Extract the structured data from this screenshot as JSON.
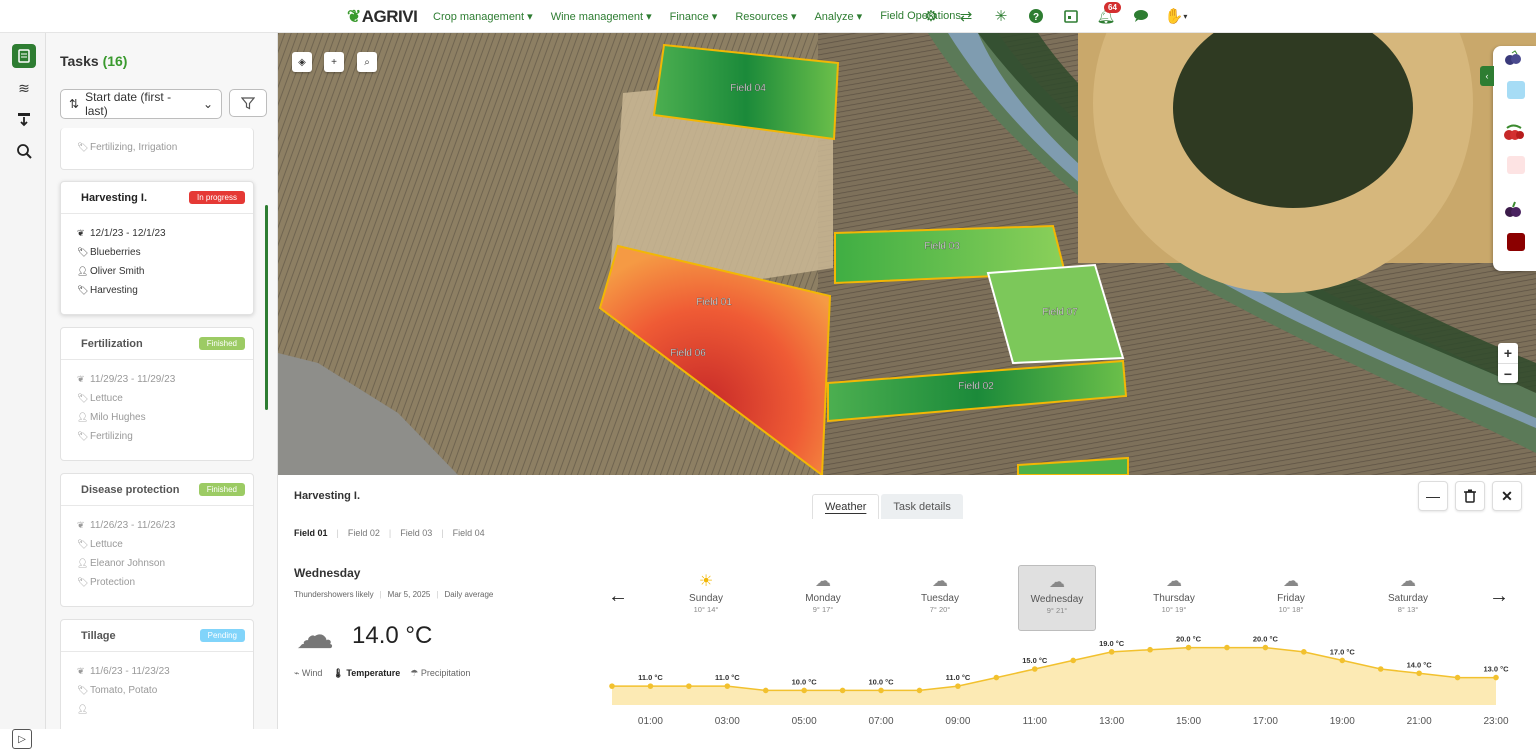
{
  "app": {
    "logo": "AGRIVI"
  },
  "nav": {
    "items": [
      "Crop management",
      "Wine management",
      "Finance",
      "Resources",
      "Analyze",
      "Field Operations"
    ],
    "notifications_count": "64",
    "icons": [
      "gear-icon",
      "transfer-icon",
      "network-icon",
      "help-icon",
      "calendar-icon",
      "bell-icon",
      "chat-icon",
      "user-icon"
    ]
  },
  "tasks": {
    "title": "Tasks",
    "count": "(16)",
    "sort_label": "Start date (first - last)",
    "partial_tag": "Fertilizing, Irrigation",
    "cards": [
      {
        "name": "Harvesting I.",
        "status": "In progress",
        "date": "12/1/23 - 12/1/23",
        "crop": "Blueberries",
        "person": "Oliver Smith",
        "type": "Harvesting"
      },
      {
        "name": "Fertilization",
        "status": "Finished",
        "date": "11/29/23 - 11/29/23",
        "crop": "Lettuce",
        "person": "Milo Hughes",
        "type": "Fertilizing"
      },
      {
        "name": "Disease protection",
        "status": "Finished",
        "date": "11/26/23 - 11/26/23",
        "crop": "Lettuce",
        "person": "Eleanor Johnson",
        "type": "Protection"
      },
      {
        "name": "Tillage",
        "status": "Pending",
        "date": "11/6/23 - 11/23/23",
        "crop": "Tomato, Potato",
        "person": "",
        "type": ""
      }
    ]
  },
  "map": {
    "fields": [
      "Field 04",
      "Field 03",
      "Field 01",
      "Field 06",
      "Field 07",
      "Field 02"
    ],
    "palette_colors": [
      "#a6dcf5",
      "#fde3e3",
      "#8b0000"
    ]
  },
  "details": {
    "title": "Harvesting I.",
    "tabs": [
      "Weather",
      "Task details"
    ],
    "field_tabs": [
      "Field 01",
      "Field 02",
      "Field 03",
      "Field 04"
    ],
    "day": "Wednesday",
    "condition": "Thundershowers likely",
    "date": "Mar 5, 2025",
    "avg_label": "Daily average",
    "temp": "14.0 °C",
    "metrics": [
      "Wind",
      "Temperature",
      "Precipitation"
    ],
    "week": [
      {
        "day": "Sunday",
        "hl": "10° 14°"
      },
      {
        "day": "Monday",
        "hl": "9° 17°"
      },
      {
        "day": "Tuesday",
        "hl": "7° 20°"
      },
      {
        "day": "Wednesday",
        "hl": "9° 21°"
      },
      {
        "day": "Thursday",
        "hl": "10° 19°"
      },
      {
        "day": "Friday",
        "hl": "10° 18°"
      },
      {
        "day": "Saturday",
        "hl": "8° 13°"
      }
    ]
  },
  "chart_data": {
    "type": "area",
    "x": [
      "00:00",
      "01:00",
      "02:00",
      "03:00",
      "04:00",
      "05:00",
      "06:00",
      "07:00",
      "08:00",
      "09:00",
      "10:00",
      "11:00",
      "12:00",
      "13:00",
      "14:00",
      "15:00",
      "16:00",
      "17:00",
      "18:00",
      "19:00",
      "20:00",
      "21:00",
      "22:00",
      "23:00"
    ],
    "tick_labels": [
      "01:00",
      "03:00",
      "05:00",
      "07:00",
      "09:00",
      "11:00",
      "13:00",
      "15:00",
      "17:00",
      "19:00",
      "21:00",
      "23:00"
    ],
    "values": [
      11.0,
      11.0,
      11.0,
      11.0,
      10.0,
      10.0,
      10.0,
      10.0,
      10.0,
      11.0,
      13.0,
      15.0,
      17.0,
      19.0,
      19.5,
      20.0,
      20.0,
      20.0,
      19.0,
      17.0,
      15.0,
      14.0,
      13.0,
      13.0
    ],
    "data_labels": [
      {
        "i": 1,
        "text": "11.0 °C"
      },
      {
        "i": 3,
        "text": "11.0 °C"
      },
      {
        "i": 5,
        "text": "10.0 °C"
      },
      {
        "i": 7,
        "text": "10.0 °C"
      },
      {
        "i": 9,
        "text": "11.0 °C"
      },
      {
        "i": 11,
        "text": "15.0 °C"
      },
      {
        "i": 13,
        "text": "19.0 °C"
      },
      {
        "i": 15,
        "text": "20.0 °C"
      },
      {
        "i": 17,
        "text": "20.0 °C"
      },
      {
        "i": 19,
        "text": "17.0 °C"
      },
      {
        "i": 21,
        "text": "14.0 °C"
      },
      {
        "i": 23,
        "text": "13.0 °C"
      }
    ],
    "ylim": [
      0,
      22
    ],
    "colors": {
      "fill": "#fbe39b",
      "line": "#f2c12e",
      "point": "#f2c12e"
    }
  }
}
